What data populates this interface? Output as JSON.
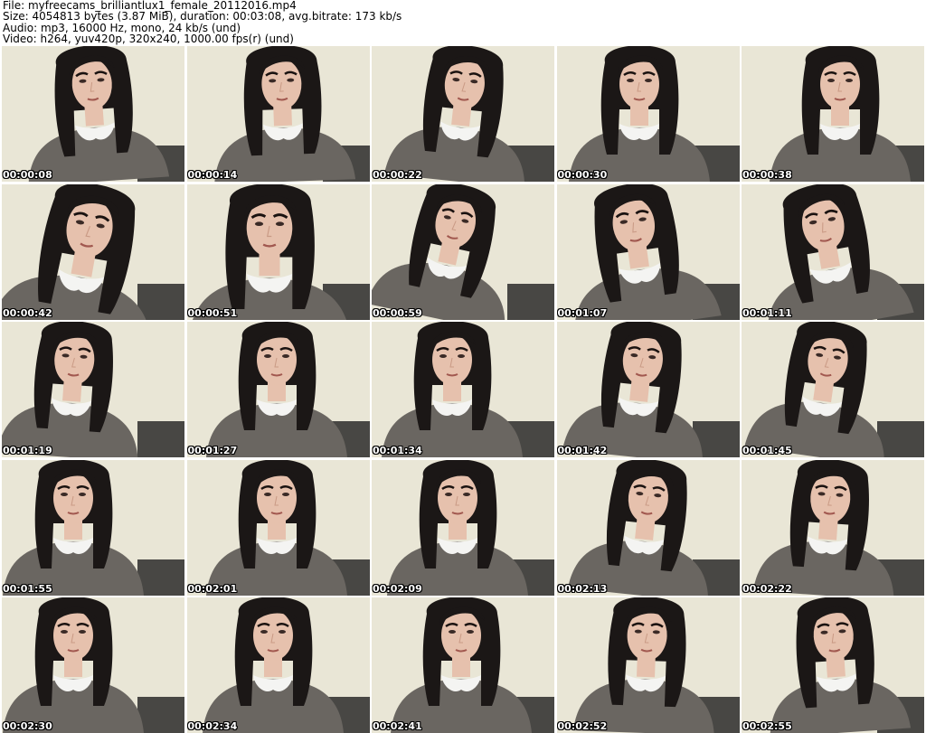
{
  "header": {
    "file_line": "File: myfreecams_brilliantlux1_female_20112016.mp4",
    "size_line": "Size: 4054813 bytes (3.87 MiB), duration: 00:03:08, avg.bitrate: 173 kb/s",
    "audio_line": "Audio: mp3, 16000 Hz, mono, 24 kb/s (und)",
    "video_line": "Video: h264, yuv420p, 320x240, 1000.00 fps(r) (und)"
  },
  "colors": {
    "background": "#ffffff",
    "wall": "#e9e6d6",
    "hair": "#1b1716",
    "skin": "#e6c1ad",
    "dress": "#6a6661",
    "collar": "#f4f4f2",
    "timestamp_text": "#ffffff",
    "timestamp_outline": "#000000"
  },
  "thumbnails": [
    {
      "timestamp": "00:00:08"
    },
    {
      "timestamp": "00:00:14"
    },
    {
      "timestamp": "00:00:22"
    },
    {
      "timestamp": "00:00:30"
    },
    {
      "timestamp": "00:00:38"
    },
    {
      "timestamp": "00:00:42"
    },
    {
      "timestamp": "00:00:51"
    },
    {
      "timestamp": "00:00:59"
    },
    {
      "timestamp": "00:01:07"
    },
    {
      "timestamp": "00:01:11"
    },
    {
      "timestamp": "00:01:19"
    },
    {
      "timestamp": "00:01:27"
    },
    {
      "timestamp": "00:01:34"
    },
    {
      "timestamp": "00:01:42"
    },
    {
      "timestamp": "00:01:45"
    },
    {
      "timestamp": "00:01:55"
    },
    {
      "timestamp": "00:02:01"
    },
    {
      "timestamp": "00:02:09"
    },
    {
      "timestamp": "00:02:13"
    },
    {
      "timestamp": "00:02:22"
    },
    {
      "timestamp": "00:02:30"
    },
    {
      "timestamp": "00:02:34"
    },
    {
      "timestamp": "00:02:41"
    },
    {
      "timestamp": "00:02:52"
    },
    {
      "timestamp": "00:02:55"
    }
  ]
}
